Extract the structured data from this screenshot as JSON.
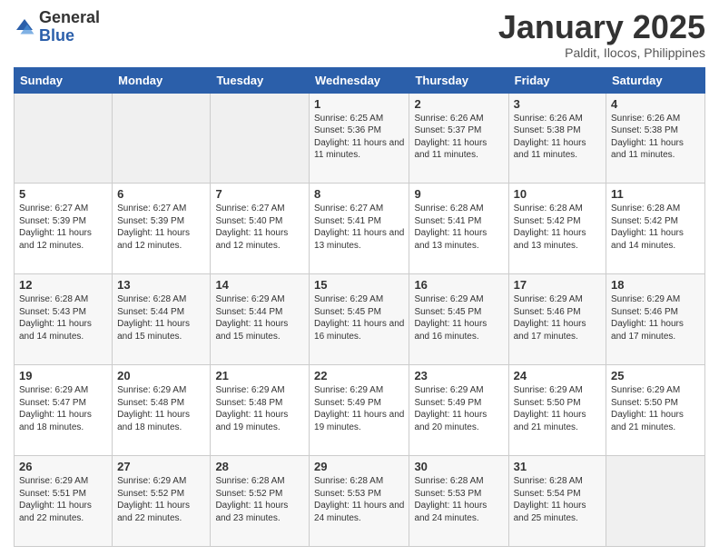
{
  "header": {
    "logo_general": "General",
    "logo_blue": "Blue",
    "month_title": "January 2025",
    "subtitle": "Paldit, Ilocos, Philippines"
  },
  "days_of_week": [
    "Sunday",
    "Monday",
    "Tuesday",
    "Wednesday",
    "Thursday",
    "Friday",
    "Saturday"
  ],
  "weeks": [
    [
      {
        "day": "",
        "info": ""
      },
      {
        "day": "",
        "info": ""
      },
      {
        "day": "",
        "info": ""
      },
      {
        "day": "1",
        "info": "Sunrise: 6:25 AM\nSunset: 5:36 PM\nDaylight: 11 hours and 11 minutes."
      },
      {
        "day": "2",
        "info": "Sunrise: 6:26 AM\nSunset: 5:37 PM\nDaylight: 11 hours and 11 minutes."
      },
      {
        "day": "3",
        "info": "Sunrise: 6:26 AM\nSunset: 5:38 PM\nDaylight: 11 hours and 11 minutes."
      },
      {
        "day": "4",
        "info": "Sunrise: 6:26 AM\nSunset: 5:38 PM\nDaylight: 11 hours and 11 minutes."
      }
    ],
    [
      {
        "day": "5",
        "info": "Sunrise: 6:27 AM\nSunset: 5:39 PM\nDaylight: 11 hours and 12 minutes."
      },
      {
        "day": "6",
        "info": "Sunrise: 6:27 AM\nSunset: 5:39 PM\nDaylight: 11 hours and 12 minutes."
      },
      {
        "day": "7",
        "info": "Sunrise: 6:27 AM\nSunset: 5:40 PM\nDaylight: 11 hours and 12 minutes."
      },
      {
        "day": "8",
        "info": "Sunrise: 6:27 AM\nSunset: 5:41 PM\nDaylight: 11 hours and 13 minutes."
      },
      {
        "day": "9",
        "info": "Sunrise: 6:28 AM\nSunset: 5:41 PM\nDaylight: 11 hours and 13 minutes."
      },
      {
        "day": "10",
        "info": "Sunrise: 6:28 AM\nSunset: 5:42 PM\nDaylight: 11 hours and 13 minutes."
      },
      {
        "day": "11",
        "info": "Sunrise: 6:28 AM\nSunset: 5:42 PM\nDaylight: 11 hours and 14 minutes."
      }
    ],
    [
      {
        "day": "12",
        "info": "Sunrise: 6:28 AM\nSunset: 5:43 PM\nDaylight: 11 hours and 14 minutes."
      },
      {
        "day": "13",
        "info": "Sunrise: 6:28 AM\nSunset: 5:44 PM\nDaylight: 11 hours and 15 minutes."
      },
      {
        "day": "14",
        "info": "Sunrise: 6:29 AM\nSunset: 5:44 PM\nDaylight: 11 hours and 15 minutes."
      },
      {
        "day": "15",
        "info": "Sunrise: 6:29 AM\nSunset: 5:45 PM\nDaylight: 11 hours and 16 minutes."
      },
      {
        "day": "16",
        "info": "Sunrise: 6:29 AM\nSunset: 5:45 PM\nDaylight: 11 hours and 16 minutes."
      },
      {
        "day": "17",
        "info": "Sunrise: 6:29 AM\nSunset: 5:46 PM\nDaylight: 11 hours and 17 minutes."
      },
      {
        "day": "18",
        "info": "Sunrise: 6:29 AM\nSunset: 5:46 PM\nDaylight: 11 hours and 17 minutes."
      }
    ],
    [
      {
        "day": "19",
        "info": "Sunrise: 6:29 AM\nSunset: 5:47 PM\nDaylight: 11 hours and 18 minutes."
      },
      {
        "day": "20",
        "info": "Sunrise: 6:29 AM\nSunset: 5:48 PM\nDaylight: 11 hours and 18 minutes."
      },
      {
        "day": "21",
        "info": "Sunrise: 6:29 AM\nSunset: 5:48 PM\nDaylight: 11 hours and 19 minutes."
      },
      {
        "day": "22",
        "info": "Sunrise: 6:29 AM\nSunset: 5:49 PM\nDaylight: 11 hours and 19 minutes."
      },
      {
        "day": "23",
        "info": "Sunrise: 6:29 AM\nSunset: 5:49 PM\nDaylight: 11 hours and 20 minutes."
      },
      {
        "day": "24",
        "info": "Sunrise: 6:29 AM\nSunset: 5:50 PM\nDaylight: 11 hours and 21 minutes."
      },
      {
        "day": "25",
        "info": "Sunrise: 6:29 AM\nSunset: 5:50 PM\nDaylight: 11 hours and 21 minutes."
      }
    ],
    [
      {
        "day": "26",
        "info": "Sunrise: 6:29 AM\nSunset: 5:51 PM\nDaylight: 11 hours and 22 minutes."
      },
      {
        "day": "27",
        "info": "Sunrise: 6:29 AM\nSunset: 5:52 PM\nDaylight: 11 hours and 22 minutes."
      },
      {
        "day": "28",
        "info": "Sunrise: 6:28 AM\nSunset: 5:52 PM\nDaylight: 11 hours and 23 minutes."
      },
      {
        "day": "29",
        "info": "Sunrise: 6:28 AM\nSunset: 5:53 PM\nDaylight: 11 hours and 24 minutes."
      },
      {
        "day": "30",
        "info": "Sunrise: 6:28 AM\nSunset: 5:53 PM\nDaylight: 11 hours and 24 minutes."
      },
      {
        "day": "31",
        "info": "Sunrise: 6:28 AM\nSunset: 5:54 PM\nDaylight: 11 hours and 25 minutes."
      },
      {
        "day": "",
        "info": ""
      }
    ]
  ]
}
